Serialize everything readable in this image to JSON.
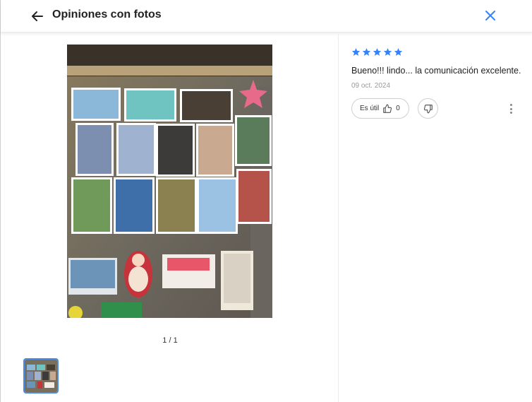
{
  "header": {
    "title": "Opiniones con fotos",
    "back_icon": "arrow-left-icon",
    "close_icon": "close-icon",
    "close_color": "#3483fa"
  },
  "viewer": {
    "counter": "1 / 1",
    "image_alt": "Foto de la opinión: imanes y fotos en la heladera",
    "thumbnail_selected": true
  },
  "review": {
    "rating": 5,
    "max_rating": 5,
    "star_color": "#3483fa",
    "text": "Bueno!!! lindo... la comunicación excelente.",
    "date": "09 oct. 2024",
    "useful_label": "Es útil",
    "useful_count": "0",
    "like_icon": "thumbs-up-icon",
    "dislike_icon": "thumbs-down-icon",
    "more_icon": "more-vertical-icon"
  }
}
